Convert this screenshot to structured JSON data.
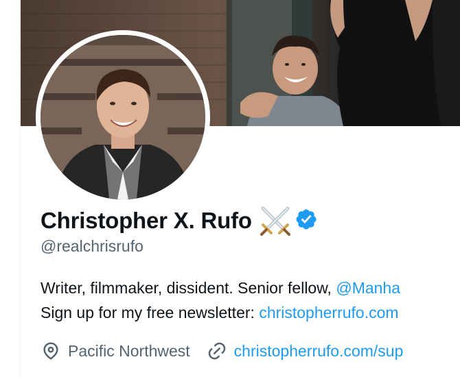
{
  "profile": {
    "display_name": "Christopher X. Rufo",
    "handle": "@realchrisrufo",
    "name_emoji": "crossed-swords-icon",
    "verified_badge": "verified-badge-icon",
    "bio": {
      "line1_text": "Writer, filmmaker, dissident. Senior fellow, ",
      "line1_mention": "@Manha",
      "line2_text": "Sign up for my free newsletter: ",
      "line2_link": "christopherrufo.com"
    },
    "location": "Pacific Northwest",
    "website": "christopherrufo.com/sup"
  },
  "colors": {
    "link": "#1d9bf0",
    "secondary_text": "#536471",
    "primary_text": "#0f1419",
    "verified": "#1d9bf0"
  }
}
